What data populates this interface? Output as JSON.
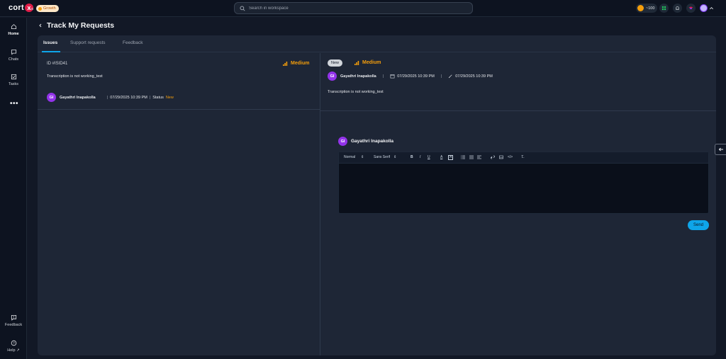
{
  "brand": {
    "logo_text": "cort",
    "logo_x": "x",
    "region": "us",
    "plan": "Growth"
  },
  "search": {
    "placeholder": "Search in workspace"
  },
  "topbar": {
    "credits": "~100"
  },
  "sidebar": {
    "items": [
      {
        "label": "Home",
        "icon": "home-icon",
        "active": true
      },
      {
        "label": "Chats",
        "icon": "chat-icon"
      },
      {
        "label": "Tasks",
        "icon": "tasks-icon"
      },
      {
        "label": "Feedback",
        "icon": "feedback-icon"
      },
      {
        "label": "Help",
        "icon": "help-icon"
      }
    ],
    "more": "•••"
  },
  "page": {
    "title": "Track My Requests"
  },
  "tabs": [
    {
      "label": "Issues",
      "active": true
    },
    {
      "label": "Support requests"
    },
    {
      "label": "Feedback"
    }
  ],
  "ticket": {
    "id": "ID #ISID41",
    "priority": "Medium",
    "description": "Transcription is not working_test",
    "initials": "GI",
    "user": "Gayathri Inapakolla",
    "datetime": "07/29/2025 10:39 PM",
    "status_label": "Status",
    "status": "New"
  },
  "detail": {
    "status_pill": "New",
    "priority": "Medium",
    "initials": "GI",
    "user": "Gayathri Inapakolla",
    "created": "07/29/2025 10:39 PM",
    "updated": "07/29/2025 10:39 PM",
    "description": "Transcription is not working_test"
  },
  "reply": {
    "initials": "GI",
    "user": "Gayathri Inapakolla",
    "toolbar": {
      "format": "Normal",
      "font": "Sans Serif"
    },
    "send_label": "Send"
  },
  "colors": {
    "accent": "#0ea5e9",
    "priority": "#f59e0b",
    "avatar": "#9333ea",
    "status_new": "#f59e0b"
  }
}
